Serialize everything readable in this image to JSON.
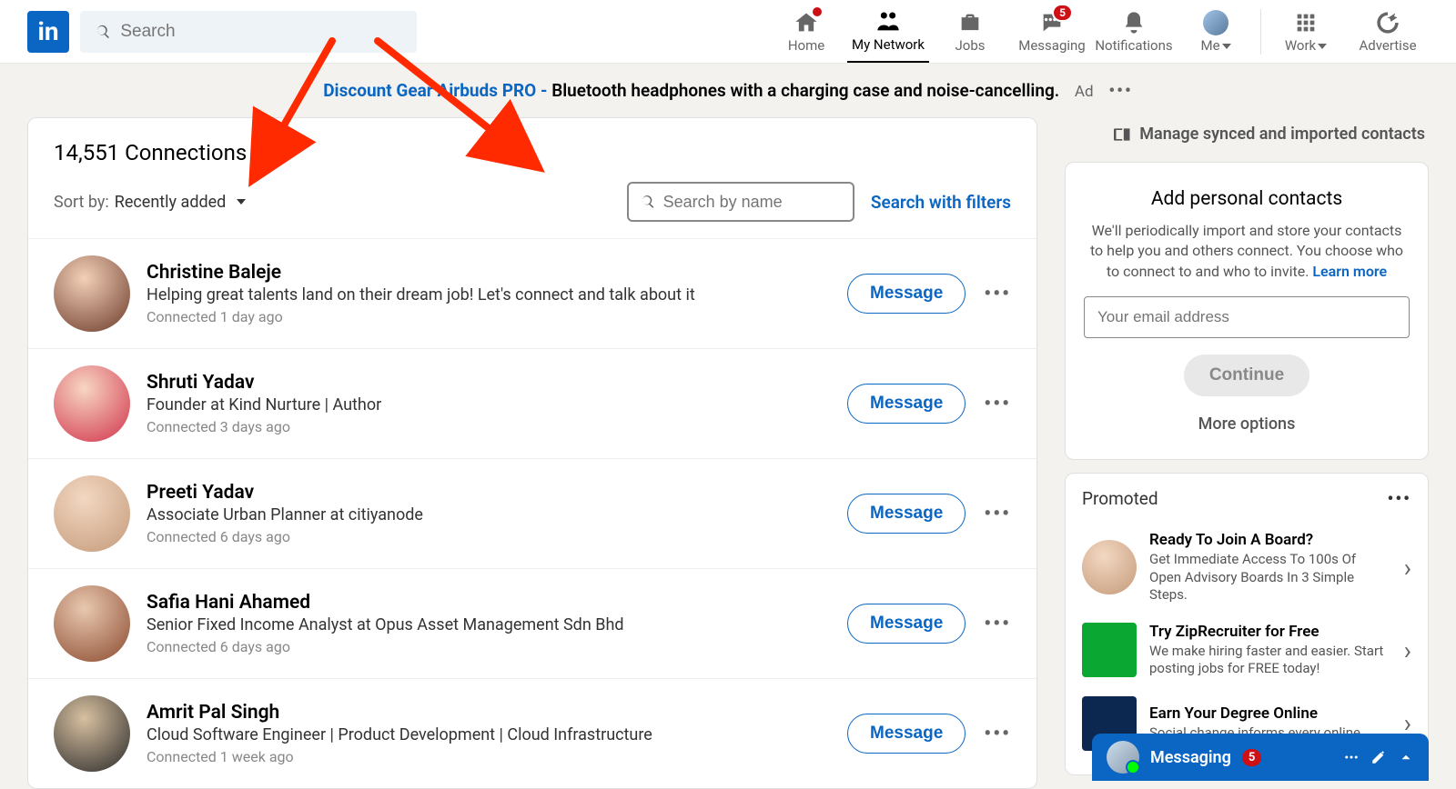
{
  "search": {
    "placeholder": "Search"
  },
  "nav": {
    "home": "Home",
    "network": "My Network",
    "jobs": "Jobs",
    "messaging": "Messaging",
    "messaging_badge": "5",
    "notifications": "Notifications",
    "me": "Me",
    "work": "Work",
    "advertise": "Advertise"
  },
  "ad": {
    "product": "Discount Gear Airbuds PRO - ",
    "text": "Bluetooth headphones with a charging case and noise-cancelling.",
    "label": "Ad",
    "more": "•••"
  },
  "connections": {
    "title": "14,551 Connections",
    "sort_label": "Sort by:",
    "sort_value": "Recently added",
    "search_placeholder": "Search by name",
    "filters_link": "Search with filters",
    "message_label": "Message",
    "items": [
      {
        "name": "Christine Baleje",
        "desc": "Helping great talents land on their dream job! Let's connect and talk about it",
        "meta": "Connected 1 day ago"
      },
      {
        "name": "Shruti Yadav",
        "desc": "Founder at Kind Nurture | Author",
        "meta": "Connected 3 days ago"
      },
      {
        "name": "Preeti Yadav",
        "desc": "Associate Urban Planner at citiyanode",
        "meta": "Connected 6 days ago"
      },
      {
        "name": "Safia Hani Ahamed",
        "desc": "Senior Fixed Income Analyst at Opus Asset Management Sdn Bhd",
        "meta": "Connected 6 days ago"
      },
      {
        "name": "Amrit Pal Singh",
        "desc": "Cloud Software Engineer | Product Development | Cloud Infrastructure",
        "meta": "Connected 1 week ago"
      }
    ]
  },
  "right": {
    "manage": "Manage synced and imported contacts",
    "contacts": {
      "title": "Add personal contacts",
      "desc": "We'll periodically import and store your contacts to help you and others connect. You choose who to connect to and who to invite. ",
      "learn": "Learn more",
      "email_placeholder": "Your email address",
      "continue": "Continue",
      "more": "More options"
    },
    "promoted": {
      "heading": "Promoted",
      "items": [
        {
          "title": "Ready To Join A Board?",
          "desc": "Get Immediate Access To 100s Of Open Advisory Boards In 3 Simple Steps."
        },
        {
          "title": "Try ZipRecruiter for Free",
          "desc": "We make hiring faster and easier. Start posting jobs for FREE today!"
        },
        {
          "title": "Earn Your Degree Online",
          "desc": "Social change informs every online"
        }
      ]
    }
  },
  "overlay": {
    "title": "Messaging",
    "badge": "5"
  }
}
